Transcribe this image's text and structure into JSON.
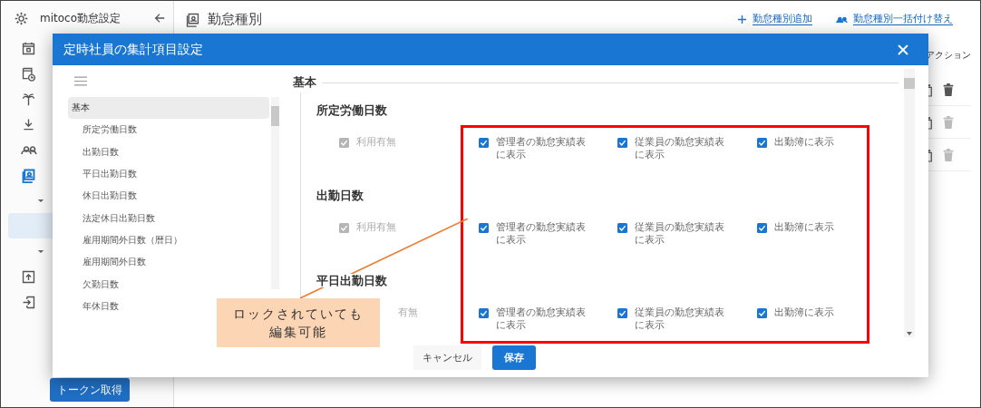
{
  "sidebar": {
    "title": "mitoco勤怠設定",
    "items": [
      {
        "kind": "calendar",
        "selected": false
      },
      {
        "kind": "clock",
        "selected": false
      },
      {
        "kind": "palm",
        "selected": false
      },
      {
        "kind": "download",
        "selected": false
      },
      {
        "kind": "people",
        "selected": false
      },
      {
        "kind": "contacts",
        "selected": true
      },
      {
        "kind": "caret",
        "selected": false
      },
      {
        "kind": "blank",
        "selected": true
      },
      {
        "kind": "caret",
        "selected": false
      },
      {
        "kind": "upload",
        "selected": false
      },
      {
        "kind": "login",
        "selected": false
      }
    ],
    "token_button": "トークン取得"
  },
  "page": {
    "title": "勤怠種別",
    "actions": [
      {
        "kind": "add",
        "label": "勤怠種別追加"
      },
      {
        "kind": "people",
        "label": "勤怠種別一括付け替え"
      }
    ],
    "table": {
      "columns": [
        "アクション"
      ],
      "rows": [
        {
          "delete_disabled": false
        },
        {
          "delete_disabled": true
        },
        {
          "delete_disabled": true
        }
      ]
    }
  },
  "modal": {
    "title": "定時社員の集計項目設定",
    "nav": [
      {
        "label": "基本",
        "selected": true,
        "children": [
          {
            "label": "所定労働日数",
            "selected": false
          },
          {
            "label": "出勤日数",
            "selected": false
          },
          {
            "label": "平日出勤日数",
            "selected": false
          },
          {
            "label": "休日出勤日数",
            "selected": false
          },
          {
            "label": "法定休日出勤日数",
            "selected": false
          },
          {
            "label": "雇用期間外日数（暦日）",
            "selected": false
          },
          {
            "label": "雇用期間外日数",
            "selected": false
          },
          {
            "label": "欠勤日数",
            "selected": false
          },
          {
            "label": "年休日数",
            "selected": false
          }
        ]
      }
    ],
    "section": "基本",
    "groups": [
      {
        "title": "所定労働日数",
        "options": [
          {
            "label": "利用有無",
            "checked": true,
            "disabled": true
          },
          {
            "label": "管理者の勤怠実績表に表示",
            "checked": true,
            "disabled": false
          },
          {
            "label": "従業員の勤怠実績表に表示",
            "checked": true,
            "disabled": false
          },
          {
            "label": "出勤簿に表示",
            "checked": true,
            "disabled": false
          }
        ]
      },
      {
        "title": "出勤日数",
        "options": [
          {
            "label": "利用有無",
            "checked": true,
            "disabled": true
          },
          {
            "label": "管理者の勤怠実績表に表示",
            "checked": true,
            "disabled": false
          },
          {
            "label": "従業員の勤怠実績表に表示",
            "checked": true,
            "disabled": false
          },
          {
            "label": "出勤簿に表示",
            "checked": true,
            "disabled": false
          }
        ]
      },
      {
        "title": "平日出勤日数",
        "options": [
          {
            "label": "有無",
            "disabled": true
          },
          {
            "label": "管理者の勤怠実績表に表示",
            "checked": true,
            "disabled": false
          },
          {
            "label": "従業員の勤怠実績表に表示",
            "checked": true,
            "disabled": false
          },
          {
            "label": "出勤簿に表示",
            "checked": true,
            "disabled": false
          }
        ]
      }
    ],
    "buttons": [
      {
        "kind": "cancel",
        "label": "キャンセル"
      },
      {
        "kind": "save",
        "label": "保存"
      }
    ]
  },
  "annotation": {
    "lines": [
      "ロックされていても",
      "編集可能"
    ]
  }
}
